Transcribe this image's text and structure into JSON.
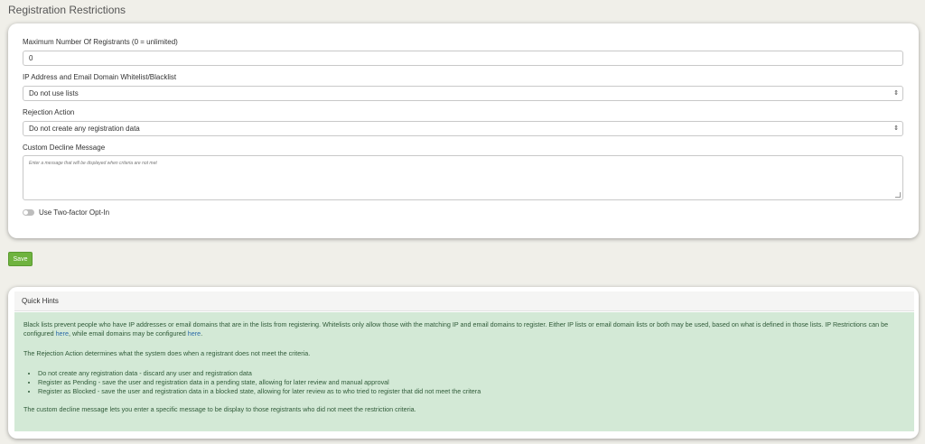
{
  "page": {
    "title": "Registration Restrictions"
  },
  "form": {
    "max_registrants": {
      "label": "Maximum Number Of Registrants (0 = unlimited)",
      "value": "0"
    },
    "lists": {
      "label": "IP Address and Email Domain Whitelist/Blacklist",
      "selected": "Do not use lists"
    },
    "rejection": {
      "label": "Rejection Action",
      "selected": "Do not create any registration data"
    },
    "decline": {
      "label": "Custom Decline Message",
      "placeholder": "Enter a message that will be displayed when criteria are not met"
    },
    "two_factor": {
      "label": "Use Two-factor Opt-In",
      "enabled": false
    }
  },
  "toolbar": {
    "save_label": "Save"
  },
  "hints": {
    "title": "Quick Hints",
    "p1_a": "Black lists prevent people who have IP addresses or email domains that are in the lists from registering. Whitelists only allow those with the matching IP and email domains to register. Either IP lists or email domain lists or both may be used, based on what is defined in those lists. IP Restrictions can be configured ",
    "link1": "here",
    "p1_b": ", while email domains may be configured ",
    "link2": "here",
    "p1_c": ".",
    "p2": "The Rejection Action determines what the system does when a registrant does not meet the criteria.",
    "items": [
      "Do not create any registration data - discard any user and registration data",
      "Register as Pending - save the user and registration data in a pending state, allowing for later review and manual approval",
      "Register as Blocked - save the user and registration data in a blocked state, allowing for later review as to who tried to register that did not meet the critera"
    ],
    "p3": "The custom decline message lets you enter a specific message to be display to those registrants who did not meet the restriction criteria."
  },
  "colors": {
    "save": "#6fb33f",
    "hint_bg": "#d3e9d6",
    "link": "#2a6aa8"
  }
}
